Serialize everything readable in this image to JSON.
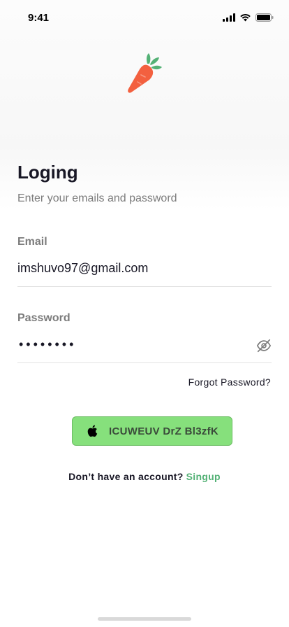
{
  "status_bar": {
    "time": "9:41",
    "icons": [
      "signal-icon",
      "wifi-icon",
      "battery-icon"
    ]
  },
  "logo": {
    "icon": "carrot-icon",
    "colors": {
      "body": "#f3603f",
      "leaves": "#53b175"
    }
  },
  "header": {
    "title": "Loging",
    "subtitle": "Enter your emails and password"
  },
  "form": {
    "email_label": "Email",
    "email_value": "imshuvo97@gmail.com",
    "password_label": "Password",
    "password_mask": "••••••••",
    "password_toggle_icon": "eye-off-icon",
    "forgot_password": "Forgot Password?"
  },
  "apple_button": {
    "icon": "apple-icon",
    "label": "ICUWEUV DrZ Bl3zfK",
    "color": "#86e07c"
  },
  "footer": {
    "prompt": "Don’t have an account?",
    "signup_link": "Singup",
    "accent_color": "#53b175"
  }
}
